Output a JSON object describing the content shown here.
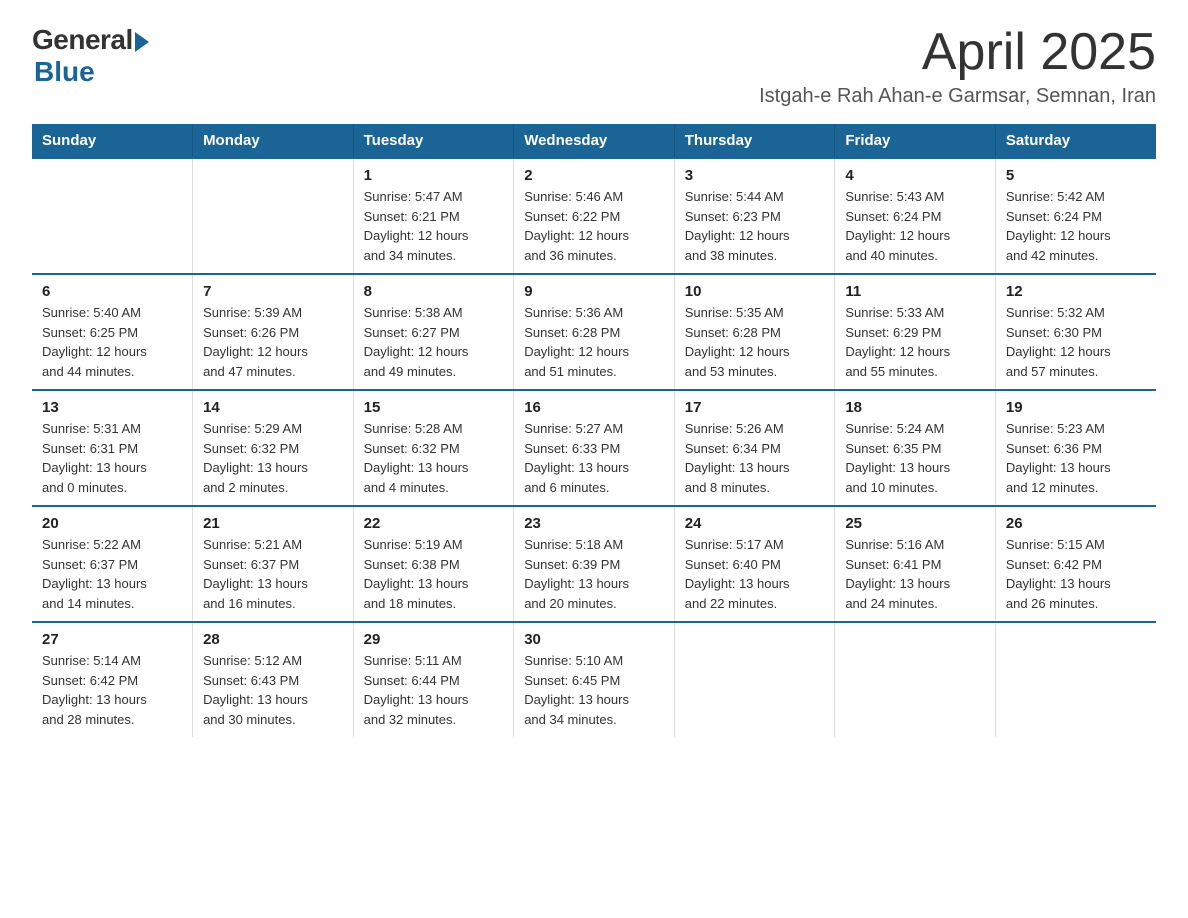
{
  "logo": {
    "general": "General",
    "blue": "Blue",
    "tagline": ""
  },
  "header": {
    "month": "April 2025",
    "location": "Istgah-e Rah Ahan-e Garmsar, Semnan, Iran"
  },
  "days_of_week": [
    "Sunday",
    "Monday",
    "Tuesday",
    "Wednesday",
    "Thursday",
    "Friday",
    "Saturday"
  ],
  "weeks": [
    [
      {
        "day": "",
        "info": ""
      },
      {
        "day": "",
        "info": ""
      },
      {
        "day": "1",
        "info": "Sunrise: 5:47 AM\nSunset: 6:21 PM\nDaylight: 12 hours\nand 34 minutes."
      },
      {
        "day": "2",
        "info": "Sunrise: 5:46 AM\nSunset: 6:22 PM\nDaylight: 12 hours\nand 36 minutes."
      },
      {
        "day": "3",
        "info": "Sunrise: 5:44 AM\nSunset: 6:23 PM\nDaylight: 12 hours\nand 38 minutes."
      },
      {
        "day": "4",
        "info": "Sunrise: 5:43 AM\nSunset: 6:24 PM\nDaylight: 12 hours\nand 40 minutes."
      },
      {
        "day": "5",
        "info": "Sunrise: 5:42 AM\nSunset: 6:24 PM\nDaylight: 12 hours\nand 42 minutes."
      }
    ],
    [
      {
        "day": "6",
        "info": "Sunrise: 5:40 AM\nSunset: 6:25 PM\nDaylight: 12 hours\nand 44 minutes."
      },
      {
        "day": "7",
        "info": "Sunrise: 5:39 AM\nSunset: 6:26 PM\nDaylight: 12 hours\nand 47 minutes."
      },
      {
        "day": "8",
        "info": "Sunrise: 5:38 AM\nSunset: 6:27 PM\nDaylight: 12 hours\nand 49 minutes."
      },
      {
        "day": "9",
        "info": "Sunrise: 5:36 AM\nSunset: 6:28 PM\nDaylight: 12 hours\nand 51 minutes."
      },
      {
        "day": "10",
        "info": "Sunrise: 5:35 AM\nSunset: 6:28 PM\nDaylight: 12 hours\nand 53 minutes."
      },
      {
        "day": "11",
        "info": "Sunrise: 5:33 AM\nSunset: 6:29 PM\nDaylight: 12 hours\nand 55 minutes."
      },
      {
        "day": "12",
        "info": "Sunrise: 5:32 AM\nSunset: 6:30 PM\nDaylight: 12 hours\nand 57 minutes."
      }
    ],
    [
      {
        "day": "13",
        "info": "Sunrise: 5:31 AM\nSunset: 6:31 PM\nDaylight: 13 hours\nand 0 minutes."
      },
      {
        "day": "14",
        "info": "Sunrise: 5:29 AM\nSunset: 6:32 PM\nDaylight: 13 hours\nand 2 minutes."
      },
      {
        "day": "15",
        "info": "Sunrise: 5:28 AM\nSunset: 6:32 PM\nDaylight: 13 hours\nand 4 minutes."
      },
      {
        "day": "16",
        "info": "Sunrise: 5:27 AM\nSunset: 6:33 PM\nDaylight: 13 hours\nand 6 minutes."
      },
      {
        "day": "17",
        "info": "Sunrise: 5:26 AM\nSunset: 6:34 PM\nDaylight: 13 hours\nand 8 minutes."
      },
      {
        "day": "18",
        "info": "Sunrise: 5:24 AM\nSunset: 6:35 PM\nDaylight: 13 hours\nand 10 minutes."
      },
      {
        "day": "19",
        "info": "Sunrise: 5:23 AM\nSunset: 6:36 PM\nDaylight: 13 hours\nand 12 minutes."
      }
    ],
    [
      {
        "day": "20",
        "info": "Sunrise: 5:22 AM\nSunset: 6:37 PM\nDaylight: 13 hours\nand 14 minutes."
      },
      {
        "day": "21",
        "info": "Sunrise: 5:21 AM\nSunset: 6:37 PM\nDaylight: 13 hours\nand 16 minutes."
      },
      {
        "day": "22",
        "info": "Sunrise: 5:19 AM\nSunset: 6:38 PM\nDaylight: 13 hours\nand 18 minutes."
      },
      {
        "day": "23",
        "info": "Sunrise: 5:18 AM\nSunset: 6:39 PM\nDaylight: 13 hours\nand 20 minutes."
      },
      {
        "day": "24",
        "info": "Sunrise: 5:17 AM\nSunset: 6:40 PM\nDaylight: 13 hours\nand 22 minutes."
      },
      {
        "day": "25",
        "info": "Sunrise: 5:16 AM\nSunset: 6:41 PM\nDaylight: 13 hours\nand 24 minutes."
      },
      {
        "day": "26",
        "info": "Sunrise: 5:15 AM\nSunset: 6:42 PM\nDaylight: 13 hours\nand 26 minutes."
      }
    ],
    [
      {
        "day": "27",
        "info": "Sunrise: 5:14 AM\nSunset: 6:42 PM\nDaylight: 13 hours\nand 28 minutes."
      },
      {
        "day": "28",
        "info": "Sunrise: 5:12 AM\nSunset: 6:43 PM\nDaylight: 13 hours\nand 30 minutes."
      },
      {
        "day": "29",
        "info": "Sunrise: 5:11 AM\nSunset: 6:44 PM\nDaylight: 13 hours\nand 32 minutes."
      },
      {
        "day": "30",
        "info": "Sunrise: 5:10 AM\nSunset: 6:45 PM\nDaylight: 13 hours\nand 34 minutes."
      },
      {
        "day": "",
        "info": ""
      },
      {
        "day": "",
        "info": ""
      },
      {
        "day": "",
        "info": ""
      }
    ]
  ]
}
